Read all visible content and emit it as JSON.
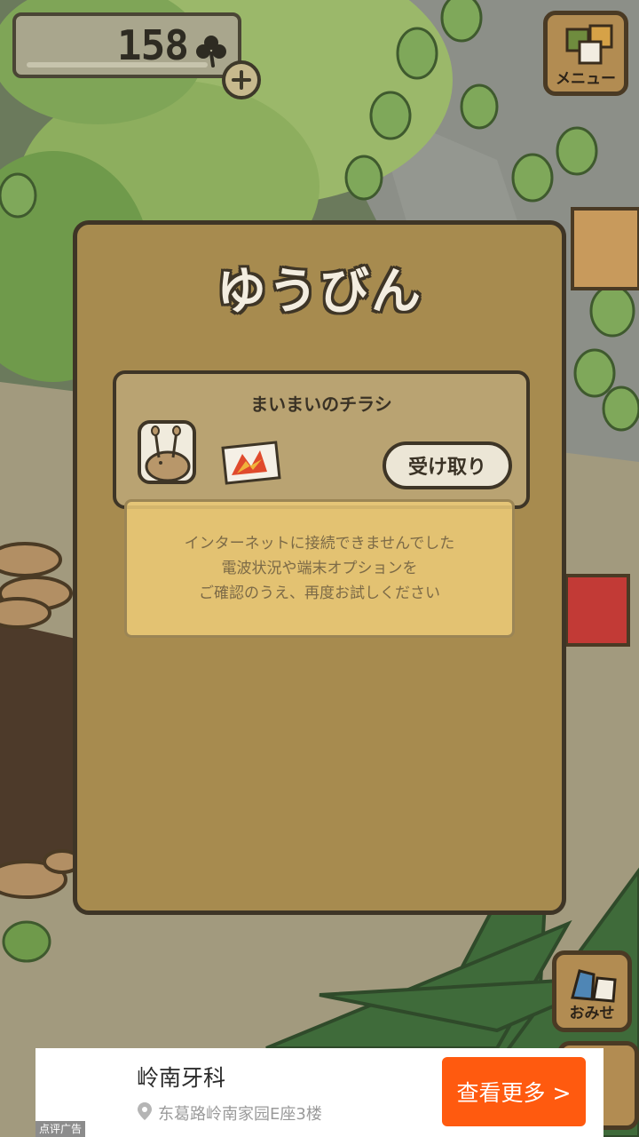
{
  "counter": {
    "value": "158",
    "icon": "clover-icon",
    "add_icon": "plus-icon"
  },
  "menu": {
    "label": "メニュー",
    "icon": "menu-cards-icon"
  },
  "shop": {
    "label": "おみせ",
    "icon": "shop-bags-icon"
  },
  "mail": {
    "title": "ゆうびん",
    "item": {
      "title": "まいまいのチラシ",
      "sender_icon": "snail-avatar-icon",
      "attachment_icon": "flyer-icon",
      "receive_label": "受け取り"
    }
  },
  "error": {
    "lines": [
      "インターネットに接続できませんでした",
      "電波状況や端末オプションを",
      "ご確認のうえ、再度お試しください"
    ]
  },
  "ad": {
    "title": "岭南牙科",
    "address": "东葛路岭南家园E座3楼",
    "cta": "查看更多 >",
    "label": "点评广告",
    "pin_icon": "location-pin-icon"
  },
  "colors": {
    "panel": "#a78b4f",
    "panel_border": "#3e3526",
    "cta": "#ff5a0f",
    "toast": "#eccb78"
  }
}
